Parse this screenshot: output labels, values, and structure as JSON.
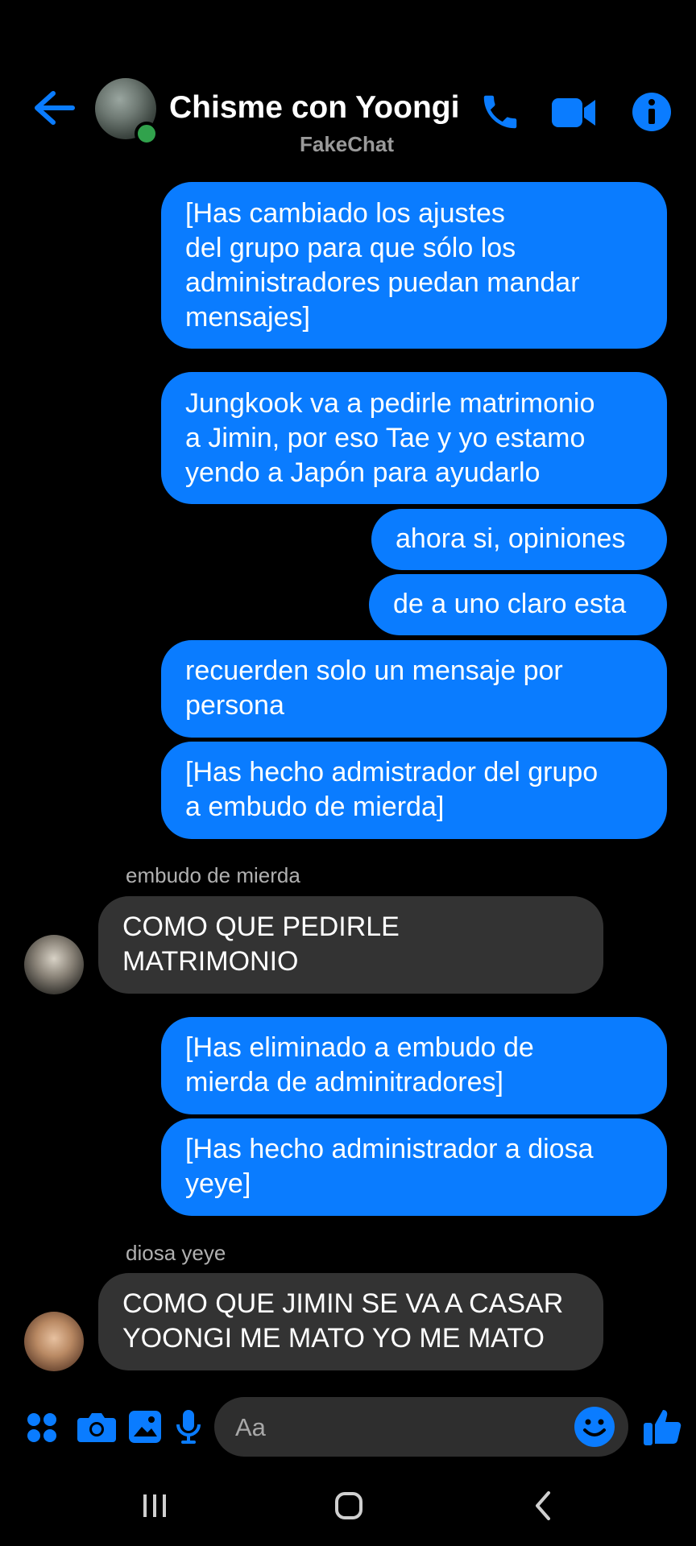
{
  "header": {
    "title": "Chisme con Yoongi",
    "subtitle": "FakeChat",
    "icons": [
      "back-arrow-icon",
      "phone-icon",
      "video-camera-icon",
      "info-icon"
    ]
  },
  "messages": [
    {
      "side": "out",
      "text": "[Has cambiado los ajustes\ndel grupo para que sólo los\nadministradores puedan mandar\nmensajes]"
    },
    {
      "side": "out",
      "text": "Jungkook va a pedirle matrimonio\na Jimin, por eso Tae y yo estamo\nyendo a Japón para ayudarlo"
    },
    {
      "side": "out",
      "text": "ahora si, opiniones"
    },
    {
      "side": "out",
      "text": "de a uno claro esta"
    },
    {
      "side": "out",
      "text": "recuerden solo un mensaje por\npersona"
    },
    {
      "side": "out",
      "text": "[Has hecho admistrador del grupo\na embudo de mierda]"
    },
    {
      "side": "in",
      "sender": "embudo de mierda",
      "text": "COMO QUE PEDIRLE\nMATRIMONIO"
    },
    {
      "side": "out",
      "text": "[Has eliminado a embudo de\nmierda de adminitradores]"
    },
    {
      "side": "out",
      "text": "[Has hecho administrador a diosa\nyeye]"
    },
    {
      "side": "in",
      "sender": "diosa yeye",
      "text": "COMO QUE JIMIN SE VA A CASAR\nYOONGI ME MATO YO ME MATO"
    }
  ],
  "composer": {
    "placeholder": "Aa",
    "icons": [
      "apps-grid-icon",
      "camera-icon",
      "gallery-icon",
      "microphone-icon",
      "emoji-icon",
      "thumbs-up-icon"
    ]
  },
  "colors": {
    "accent": "#0a7cff",
    "incoming_bubble": "#333333",
    "background": "#000000",
    "online": "#31a24c"
  }
}
